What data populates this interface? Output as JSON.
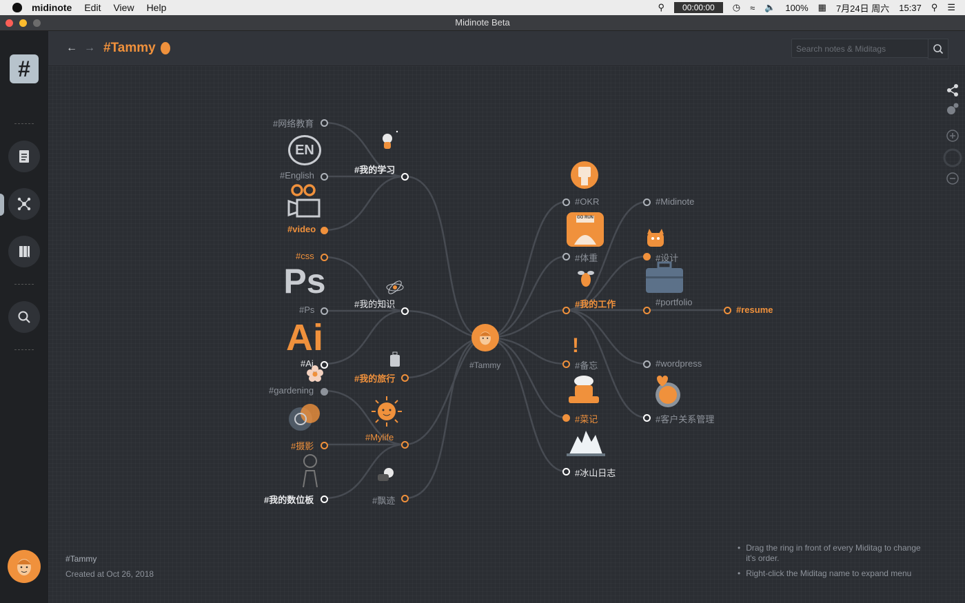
{
  "menubar": {
    "app_name": "midinote",
    "menus": [
      "Edit",
      "View",
      "Help"
    ],
    "timer": "00:00:00",
    "battery": "100%",
    "date": "7月24日 周六",
    "time": "15:37"
  },
  "window": {
    "title": "Midinote Beta"
  },
  "header": {
    "title": "#Tammy",
    "search_placeholder": "Search notes & Miditags"
  },
  "map": {
    "center": "#Tammy",
    "left_hubs": [
      "#我的学习",
      "#我的知识",
      "#我的旅行",
      "#Mylife",
      "#飘迹"
    ],
    "left_leaves": [
      "#网络教育",
      "#English",
      "#video",
      "#css",
      "#Ps",
      "#Ai",
      "#gardening",
      "#摄影",
      "#我的数位板"
    ],
    "right_hubs": [
      "#OKR",
      "#体重",
      "#我的工作",
      "#备忘",
      "#菜记",
      "#冰山日志"
    ],
    "right_leaves": [
      "#Midinote",
      "#设计",
      "#portfolio",
      "#resume",
      "#wordpress",
      "#客户关系管理"
    ],
    "icon_text": {
      "en": "EN",
      "ps": "Ps",
      "ai": "Ai",
      "gorun": "GO RUN"
    }
  },
  "footer": {
    "tag": "#Tammy",
    "created": "Created at Oct 26, 2018",
    "tips": [
      "Drag the ring in front of every Miditag to change it's order.",
      "Right-click the Miditag name to expand menu"
    ]
  },
  "colors": {
    "accent": "#f0913c",
    "bg": "#2b2e33",
    "sidebar": "#1f2124"
  }
}
